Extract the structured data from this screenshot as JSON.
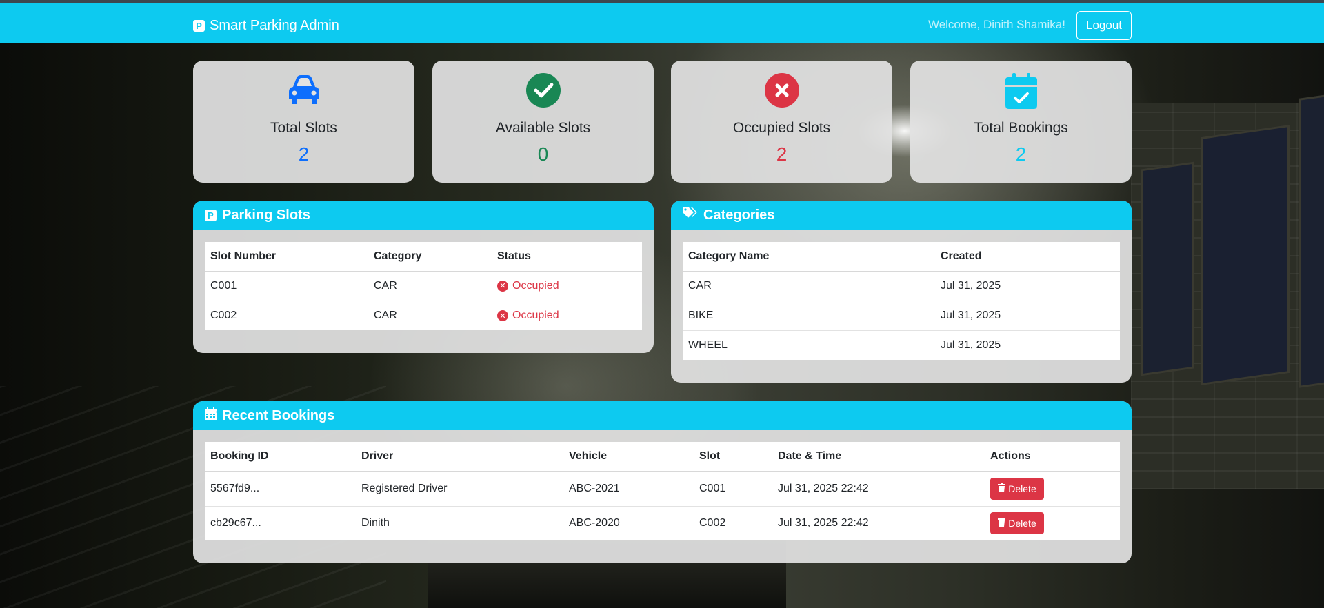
{
  "navbar": {
    "brand_icon": "P",
    "brand": "Smart Parking Admin",
    "welcome": "Welcome, Dinith Shamika!",
    "logout_label": "Logout",
    "accent": "#0dcaf0"
  },
  "stats": [
    {
      "icon": "car-icon",
      "label": "Total Slots",
      "value": "2",
      "color": "#0d6efd"
    },
    {
      "icon": "check-circle-icon",
      "label": "Available Slots",
      "value": "0",
      "color": "#198754"
    },
    {
      "icon": "x-circle-icon",
      "label": "Occupied Slots",
      "value": "2",
      "color": "#dc3545"
    },
    {
      "icon": "calendar-check-icon",
      "label": "Total Bookings",
      "value": "2",
      "color": "#0dcaf0"
    }
  ],
  "parking_slots": {
    "title": "Parking Slots",
    "columns": [
      "Slot Number",
      "Category",
      "Status"
    ],
    "rows": [
      {
        "slot": "C001",
        "category": "CAR",
        "status": "Occupied"
      },
      {
        "slot": "C002",
        "category": "CAR",
        "status": "Occupied"
      }
    ]
  },
  "categories": {
    "title": "Categories",
    "columns": [
      "Category Name",
      "Created"
    ],
    "rows": [
      {
        "name": "CAR",
        "created": "Jul 31, 2025"
      },
      {
        "name": "BIKE",
        "created": "Jul 31, 2025"
      },
      {
        "name": "WHEEL",
        "created": "Jul 31, 2025"
      }
    ]
  },
  "bookings": {
    "title": "Recent Bookings",
    "columns": [
      "Booking ID",
      "Driver",
      "Vehicle",
      "Slot",
      "Date & Time",
      "Actions"
    ],
    "delete_label": "Delete",
    "rows": [
      {
        "id": "5567fd9...",
        "driver": "Registered Driver",
        "vehicle": "ABC-2021",
        "slot": "C001",
        "datetime": "Jul 31, 2025 22:42"
      },
      {
        "id": "cb29c67...",
        "driver": "Dinith",
        "vehicle": "ABC-2020",
        "slot": "C002",
        "datetime": "Jul 31, 2025 22:42"
      }
    ]
  }
}
